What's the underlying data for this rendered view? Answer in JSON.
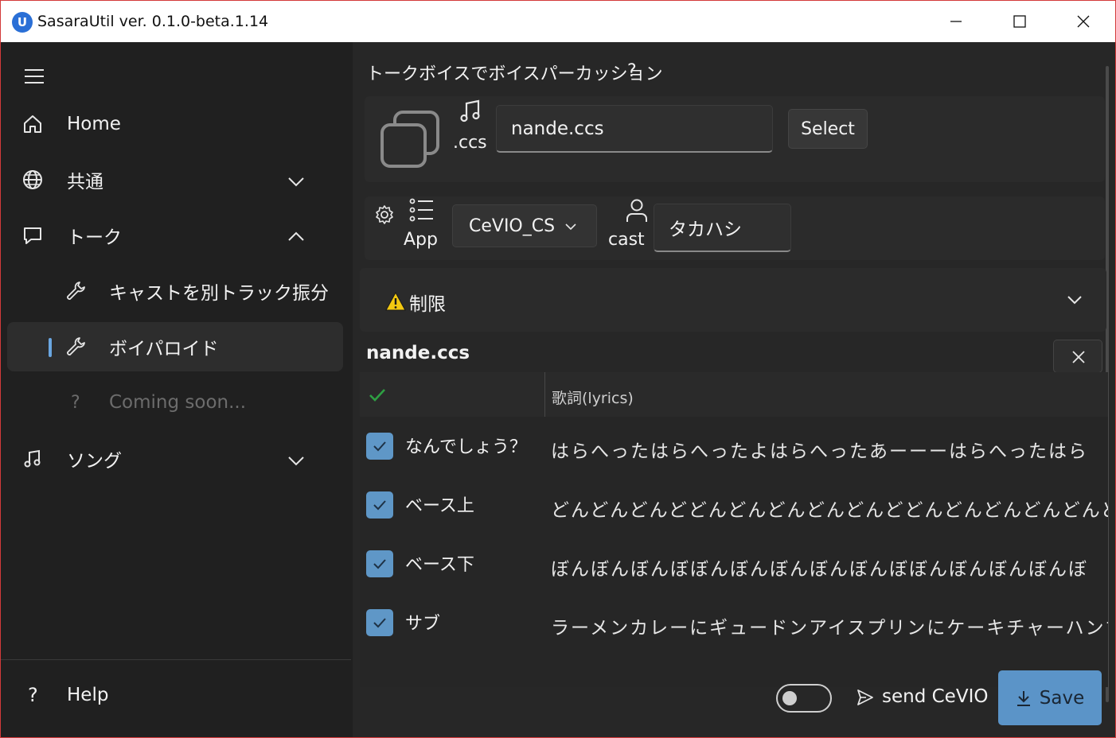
{
  "window": {
    "title": "SasaraUtil ver. 0.1.0-beta.1.14",
    "logo_letter": "U"
  },
  "sidebar": {
    "items": [
      {
        "label": "Home"
      },
      {
        "label": "共通"
      },
      {
        "label": "トーク"
      },
      {
        "label": "キャストを別トラック振分"
      },
      {
        "label": "ボイパロイド"
      },
      {
        "label": "Coming soon..."
      },
      {
        "label": "ソング"
      }
    ],
    "help_label": "Help",
    "coming_soon_mark": "?",
    "help_mark": "?"
  },
  "page": {
    "title": "トークボイスでボイスパーカッション",
    "help_mark": "?"
  },
  "file": {
    "ccs_label": ".ccs",
    "value": "nande.ccs",
    "select_label": "Select"
  },
  "app": {
    "app_label": "App",
    "selected": "CeVIO_CS",
    "cast_label": "cast",
    "cast_value": "タカハシ"
  },
  "limits": {
    "label": "制限"
  },
  "grid": {
    "title": "nande.ccs",
    "lyrics_header": "歌詞(lyrics)",
    "rows": [
      {
        "name": "なんでしょう？",
        "lyrics": "はらへったはらへったよはらへったあーーーはらへったはら",
        "checked": true
      },
      {
        "name": "ベース上",
        "lyrics": "どんどんどんどどんどんどんどんどんどどんどんどんどんどんど",
        "checked": true
      },
      {
        "name": "ベース下",
        "lyrics": "ぼんぼんぼんぼぼんぼんぼんぼんぼんぼぼんぼんぼんぼんぼ",
        "checked": true
      },
      {
        "name": "サブ",
        "lyrics": "ラーメンカレーにギュードンアイスプリンにケーキチャーハンすぶ",
        "checked": true
      }
    ]
  },
  "footer": {
    "send_label": "send CeVIO",
    "send_enabled": false,
    "save_label": "Save"
  },
  "colors": {
    "accent": "#5b94c8",
    "check": "#2ea043",
    "warning": "#f2c811"
  }
}
